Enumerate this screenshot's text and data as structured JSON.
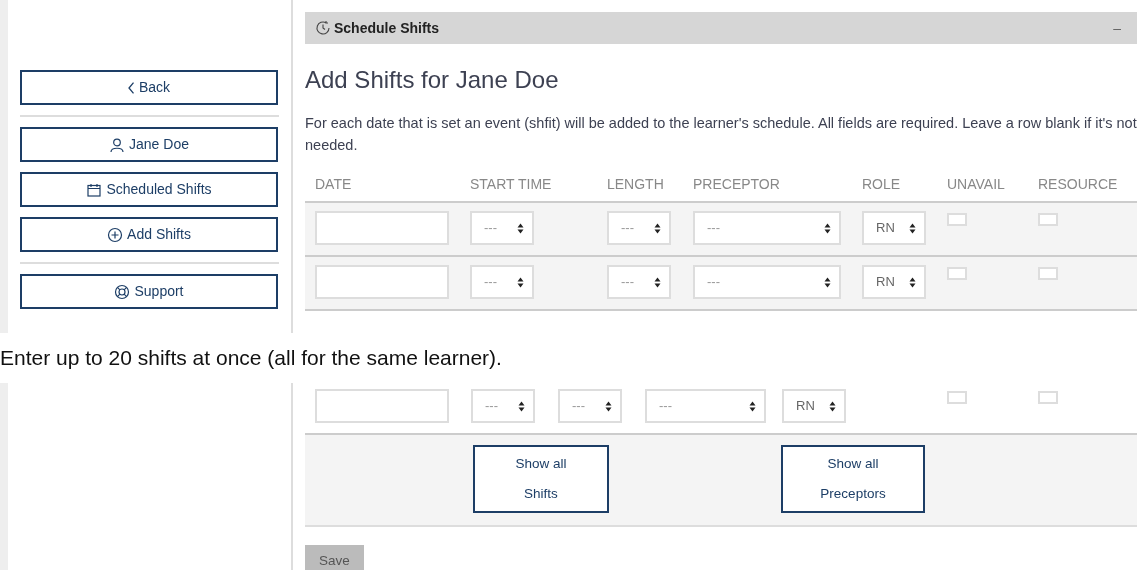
{
  "top_screen": {
    "sidebar": {
      "buttons": [
        {
          "label": "Back"
        },
        {
          "label": "Jane Doe"
        },
        {
          "label": "Scheduled Shifts"
        },
        {
          "label": "Add Shifts"
        },
        {
          "label": "Support"
        }
      ]
    },
    "panel": {
      "title": "Schedule Shifts",
      "collapse": "–"
    },
    "heading": "Add Shifts for Jane Doe",
    "description": "For each date that is set an event (shfit) will be added to the learner's schedule. All fields are required. Leave a row blank if it's not needed.",
    "columns": [
      "DATE",
      "START TIME",
      "LENGTH",
      "PRECEPTOR",
      "ROLE",
      "UNAVAIL",
      "RESOURCE"
    ],
    "rows": [
      {
        "start_time": "---",
        "length": "---",
        "preceptor": "---",
        "role": "RN",
        "unavail": false,
        "resource": false
      },
      {
        "start_time": "---",
        "length": "---",
        "preceptor": "---",
        "role": "RN",
        "unavail": false,
        "resource": false
      }
    ]
  },
  "caption": "Enter up to 20 shifts at once (all for the same learner).",
  "bottom_screen": {
    "rows": [
      {
        "start_time": "---",
        "length": "---",
        "preceptor": "---",
        "role": "RN",
        "unavail": false,
        "resource": false
      }
    ],
    "buttons": [
      "Show all Shifts",
      "Show all Preceptors"
    ],
    "save": "Save"
  }
}
